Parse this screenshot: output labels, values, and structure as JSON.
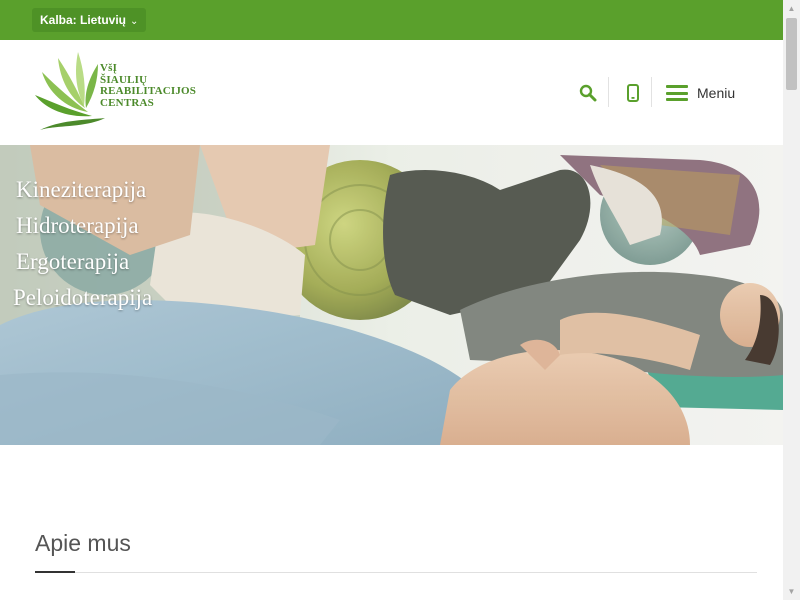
{
  "topbar": {
    "language_label": "Kalba: Lietuvių",
    "language_chevron": "chevron-down-icon",
    "background_color": "#5aa02c"
  },
  "header": {
    "logo": {
      "lines": [
        "VšĮ",
        "ŠIAULIŲ",
        "REABILITACIJOS",
        "CENTRAS"
      ],
      "color": "#4c8a2b"
    },
    "icons": [
      "search-icon",
      "phone-icon"
    ],
    "menu_label": "Meniu",
    "accent_color": "#5aa02c"
  },
  "hero": {
    "services": [
      "Kineziterapija",
      "Hidroterapija",
      "Ergoterapija",
      "Peloidoterapija"
    ]
  },
  "about": {
    "title": "Apie mus"
  }
}
